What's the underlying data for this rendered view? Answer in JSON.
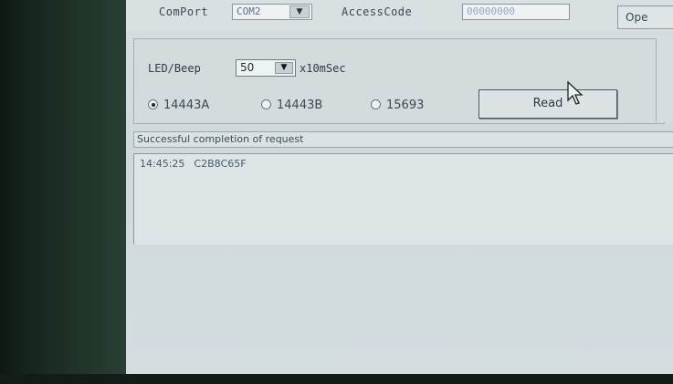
{
  "toolbar": {
    "comport_label": "ComPort",
    "comport_value": "COM2",
    "access_code_label": "AccessCode",
    "access_code_value": "00000000",
    "open_label": "Ope"
  },
  "settings": {
    "led_beep_label": "LED/Beep",
    "led_beep_value": "50",
    "led_beep_unit": "x10mSec",
    "radios": [
      {
        "label": "14443A",
        "selected": true
      },
      {
        "label": "14443B",
        "selected": false
      },
      {
        "label": "15693",
        "selected": false
      }
    ],
    "read_label": "Read"
  },
  "status": {
    "text": "Successful completion of request"
  },
  "log": {
    "entries": [
      {
        "time": "14:45:25",
        "uid": "C2B8C65F"
      }
    ]
  }
}
